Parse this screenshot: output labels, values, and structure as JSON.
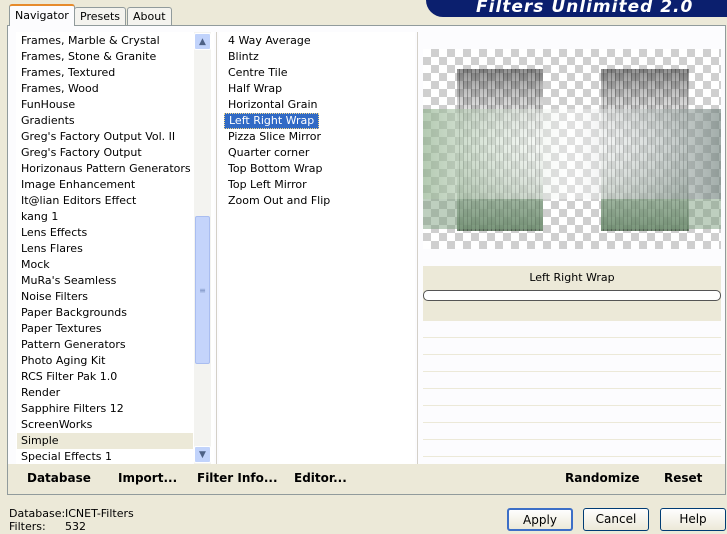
{
  "title": "Filters Unlimited 2.0",
  "tabs": [
    {
      "label": "Navigator",
      "active": true
    },
    {
      "label": "Presets",
      "active": false
    },
    {
      "label": "About",
      "active": false
    }
  ],
  "categories": [
    "Frames, Marble & Crystal",
    "Frames, Stone & Granite",
    "Frames, Textured",
    "Frames, Wood",
    "FunHouse",
    "Gradients",
    "Greg's Factory Output Vol. II",
    "Greg's Factory Output",
    "Horizonaus Pattern Generators",
    "Image Enhancement",
    "It@lian Editors Effect",
    "kang 1",
    "Lens Effects",
    "Lens Flares",
    "Mock",
    "MuRa's Seamless",
    "Noise Filters",
    "Paper Backgrounds",
    "Paper Textures",
    "Pattern Generators",
    "Photo Aging Kit",
    "RCS Filter Pak 1.0",
    "Render",
    "Sapphire Filters 12",
    "ScreenWorks",
    "Simple",
    "Special Effects 1"
  ],
  "selected_category": "Simple",
  "filters": [
    "4 Way Average",
    "Blintz",
    "Centre Tile",
    "Half Wrap",
    "Horizontal Grain",
    "Left Right Wrap",
    "Pizza Slice Mirror",
    "Quarter corner",
    "Top Bottom Wrap",
    "Top Left Mirror",
    "Zoom Out and Flip"
  ],
  "selected_filter": "Left Right Wrap",
  "preview_label": "Left Right Wrap",
  "toolbar": {
    "database": "Database",
    "import": "Import...",
    "filter_info": "Filter Info...",
    "editor": "Editor...",
    "randomize": "Randomize",
    "reset": "Reset"
  },
  "status": {
    "database_label": "Database:",
    "database_value": "ICNET-Filters",
    "filters_label": "Filters:",
    "filters_value": "532"
  },
  "buttons": {
    "apply": "Apply",
    "cancel": "Cancel",
    "help": "Help"
  },
  "icons": {
    "scroll_up": "chevron-up-icon",
    "scroll_down": "chevron-down-icon",
    "thumb_grip": "grip-icon"
  }
}
